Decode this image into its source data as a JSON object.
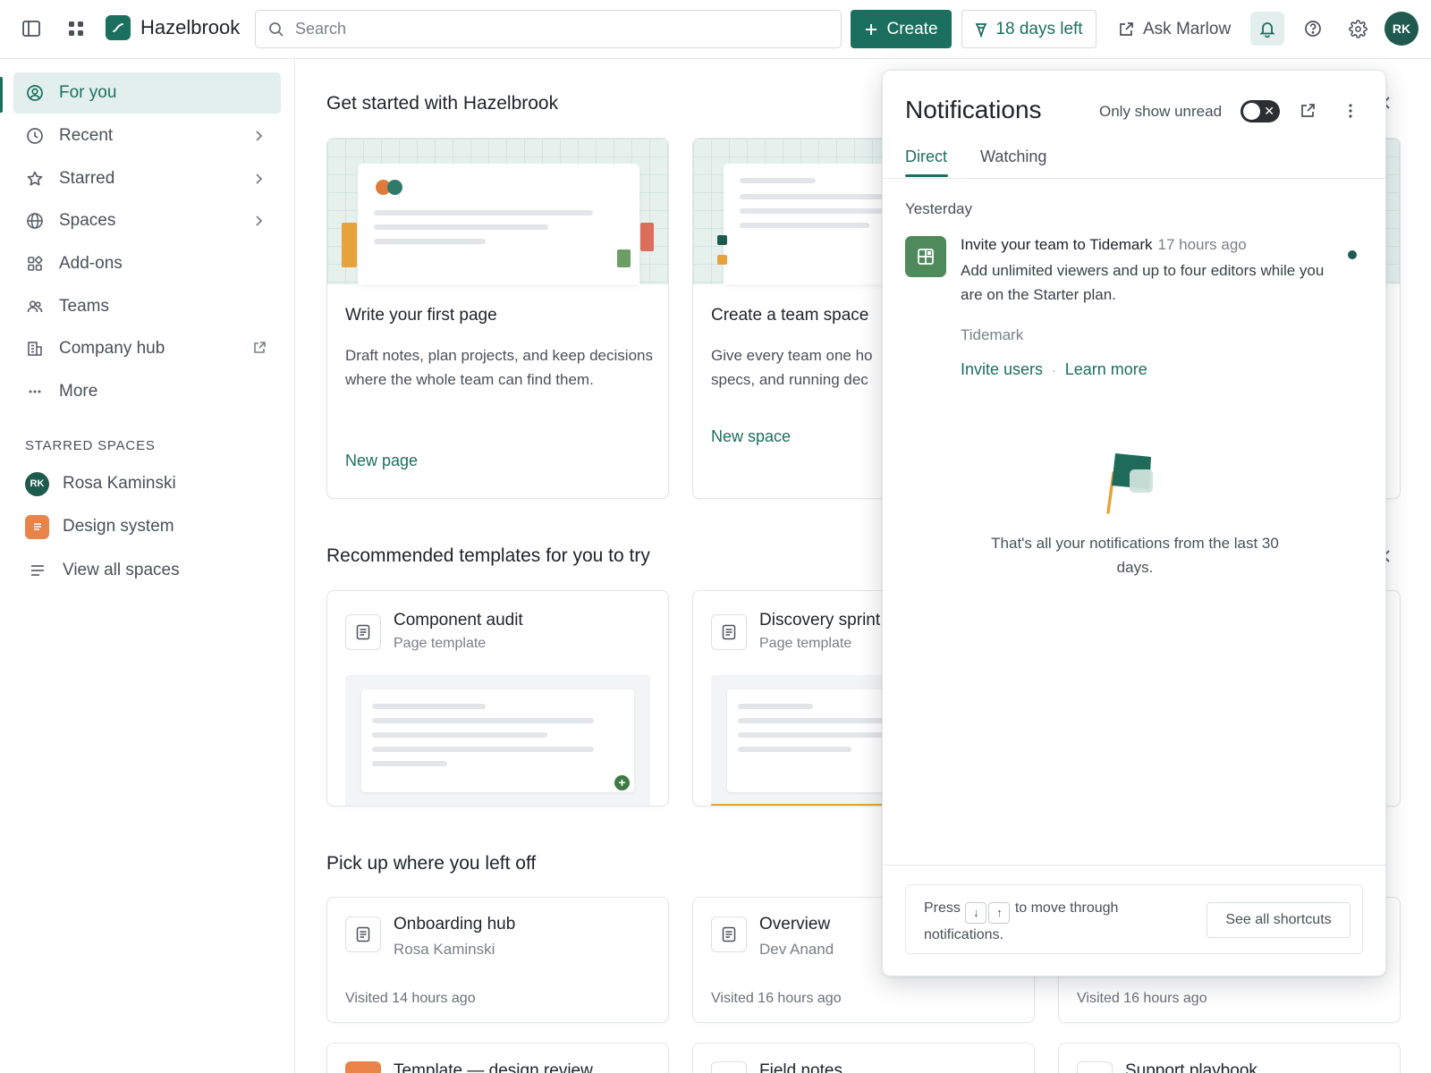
{
  "topbar": {
    "app_name": "Hazelbrook",
    "search_placeholder": "Search",
    "create_label": "Create",
    "trial_label": "18 days left",
    "ask_label": "Ask Marlow",
    "avatar_initials": "RK"
  },
  "sidebar": {
    "items": [
      {
        "label": "For you",
        "icon": "user-circle-icon"
      },
      {
        "label": "Recent",
        "icon": "clock-icon"
      },
      {
        "label": "Starred",
        "icon": "star-icon"
      },
      {
        "label": "Spaces",
        "icon": "globe-icon"
      },
      {
        "label": "Add-ons",
        "icon": "apps-icon"
      },
      {
        "label": "Teams",
        "icon": "people-icon"
      },
      {
        "label": "Company hub",
        "icon": "building-icon"
      },
      {
        "label": "More",
        "icon": "ellipsis-icon"
      }
    ],
    "starred_label": "STARRED SPACES",
    "spaces": [
      {
        "label": "Rosa Kaminski",
        "initials": "RK"
      },
      {
        "label": "Design system"
      },
      {
        "label": "View all spaces"
      }
    ]
  },
  "main": {
    "get_started_title": "Get started with Hazelbrook",
    "get_started_cards": [
      {
        "title": "Write your first page",
        "desc": "Draft notes, plan projects, and keep decisions where the whole team can find them.",
        "link": "New page"
      },
      {
        "title": "Create a team space",
        "desc": "Give every team one ho… specs, and running dec…",
        "desc_line1": "Give every team one ho",
        "desc_line2": "specs, and running dec",
        "link": "New space"
      }
    ],
    "templates_title": "Recommended templates for you to try",
    "templates": [
      {
        "title": "Component audit",
        "sub": "Page template"
      },
      {
        "title": "Discovery sprint",
        "sub": "Page template"
      }
    ],
    "recent_title": "Pick up where you left off",
    "recent": [
      {
        "title": "Onboarding hub",
        "owner": "Rosa Kaminski",
        "visited": "Visited 14 hours ago"
      },
      {
        "title": "Overview",
        "owner": "Dev Anand",
        "visited": "Visited 16 hours ago"
      },
      {
        "visited": "Visited 16 hours ago"
      }
    ],
    "more_row": [
      "Template — design review",
      "Field notes",
      "Support playbook"
    ]
  },
  "notifications": {
    "title": "Notifications",
    "unread_label": "Only show unread",
    "unread_toggle": false,
    "tabs": [
      "Direct",
      "Watching"
    ],
    "active_tab": "Direct",
    "day": "Yesterday",
    "item": {
      "title": "Invite your team to Tidemark",
      "time": "17 hours ago",
      "body": "Add unlimited viewers and up to four editors while you are on the Starter plan.",
      "source": "Tidemark",
      "action_primary": "Invite users",
      "action_secondary": "Learn more",
      "unread": true
    },
    "empty_text": "That's all your notifications from the last 30 days.",
    "footer_press": "Press",
    "footer_rest": "to move through notifications.",
    "shortcuts_label": "See all shortcuts"
  },
  "colors": {
    "accent": "#1b6f5e",
    "accent_soft": "#e3efec",
    "avatar": "#1e5a4d",
    "design_system": "#e8834a"
  }
}
